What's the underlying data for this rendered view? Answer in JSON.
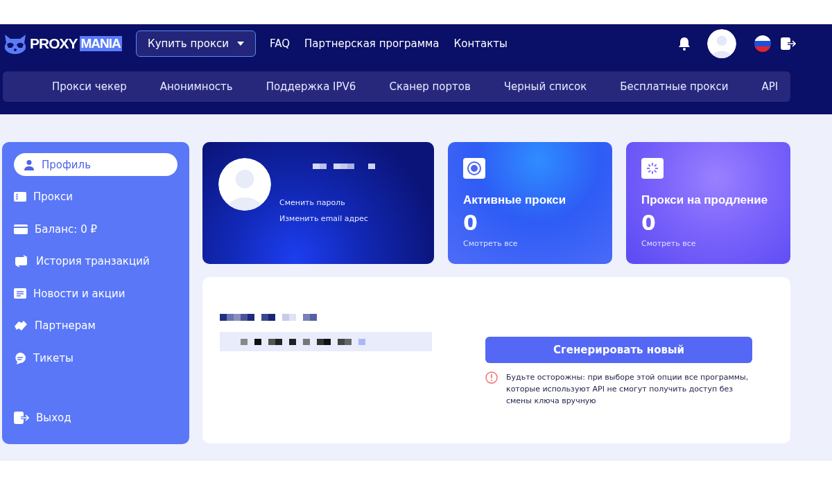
{
  "header": {
    "logo": {
      "text": "PROXY",
      "highlight": "MANIA"
    },
    "buy_dropdown": {
      "label": "Купить прокси"
    },
    "links": [
      "FAQ",
      "Партнерская программа",
      "Контакты"
    ]
  },
  "nav": [
    "Прокси чекер",
    "Анонимность",
    "Поддержка IPV6",
    "Сканер портов",
    "Черный список",
    "Бесплатные прокси",
    "API"
  ],
  "sidebar": {
    "items": [
      {
        "label": "Профиль",
        "selected": true
      },
      {
        "label": "Прокси",
        "selected": false
      },
      {
        "label": "Баланс: 0 ₽",
        "selected": false
      },
      {
        "label": "История транзакций",
        "selected": false
      },
      {
        "label": "Новости и акции",
        "selected": false
      },
      {
        "label": "Партнерам",
        "selected": false
      },
      {
        "label": "Тикеты",
        "selected": false
      }
    ],
    "logout": "Выход"
  },
  "profile": {
    "links": [
      "Сменить пароль",
      "Изменить email адрес"
    ]
  },
  "stats": [
    {
      "kind": "active",
      "title": "Активные прокси",
      "count": "0",
      "link": "Смотреть все"
    },
    {
      "kind": "renewal",
      "title": "Прокси на продление",
      "count": "0",
      "link": "Смотреть все"
    }
  ],
  "api_key": {
    "button": "Сгенерировать новый",
    "warning": "Будьте осторожны: при выборе этой опции все программы, которые используют API не смогут получить доступ без смены ключа вручную"
  }
}
